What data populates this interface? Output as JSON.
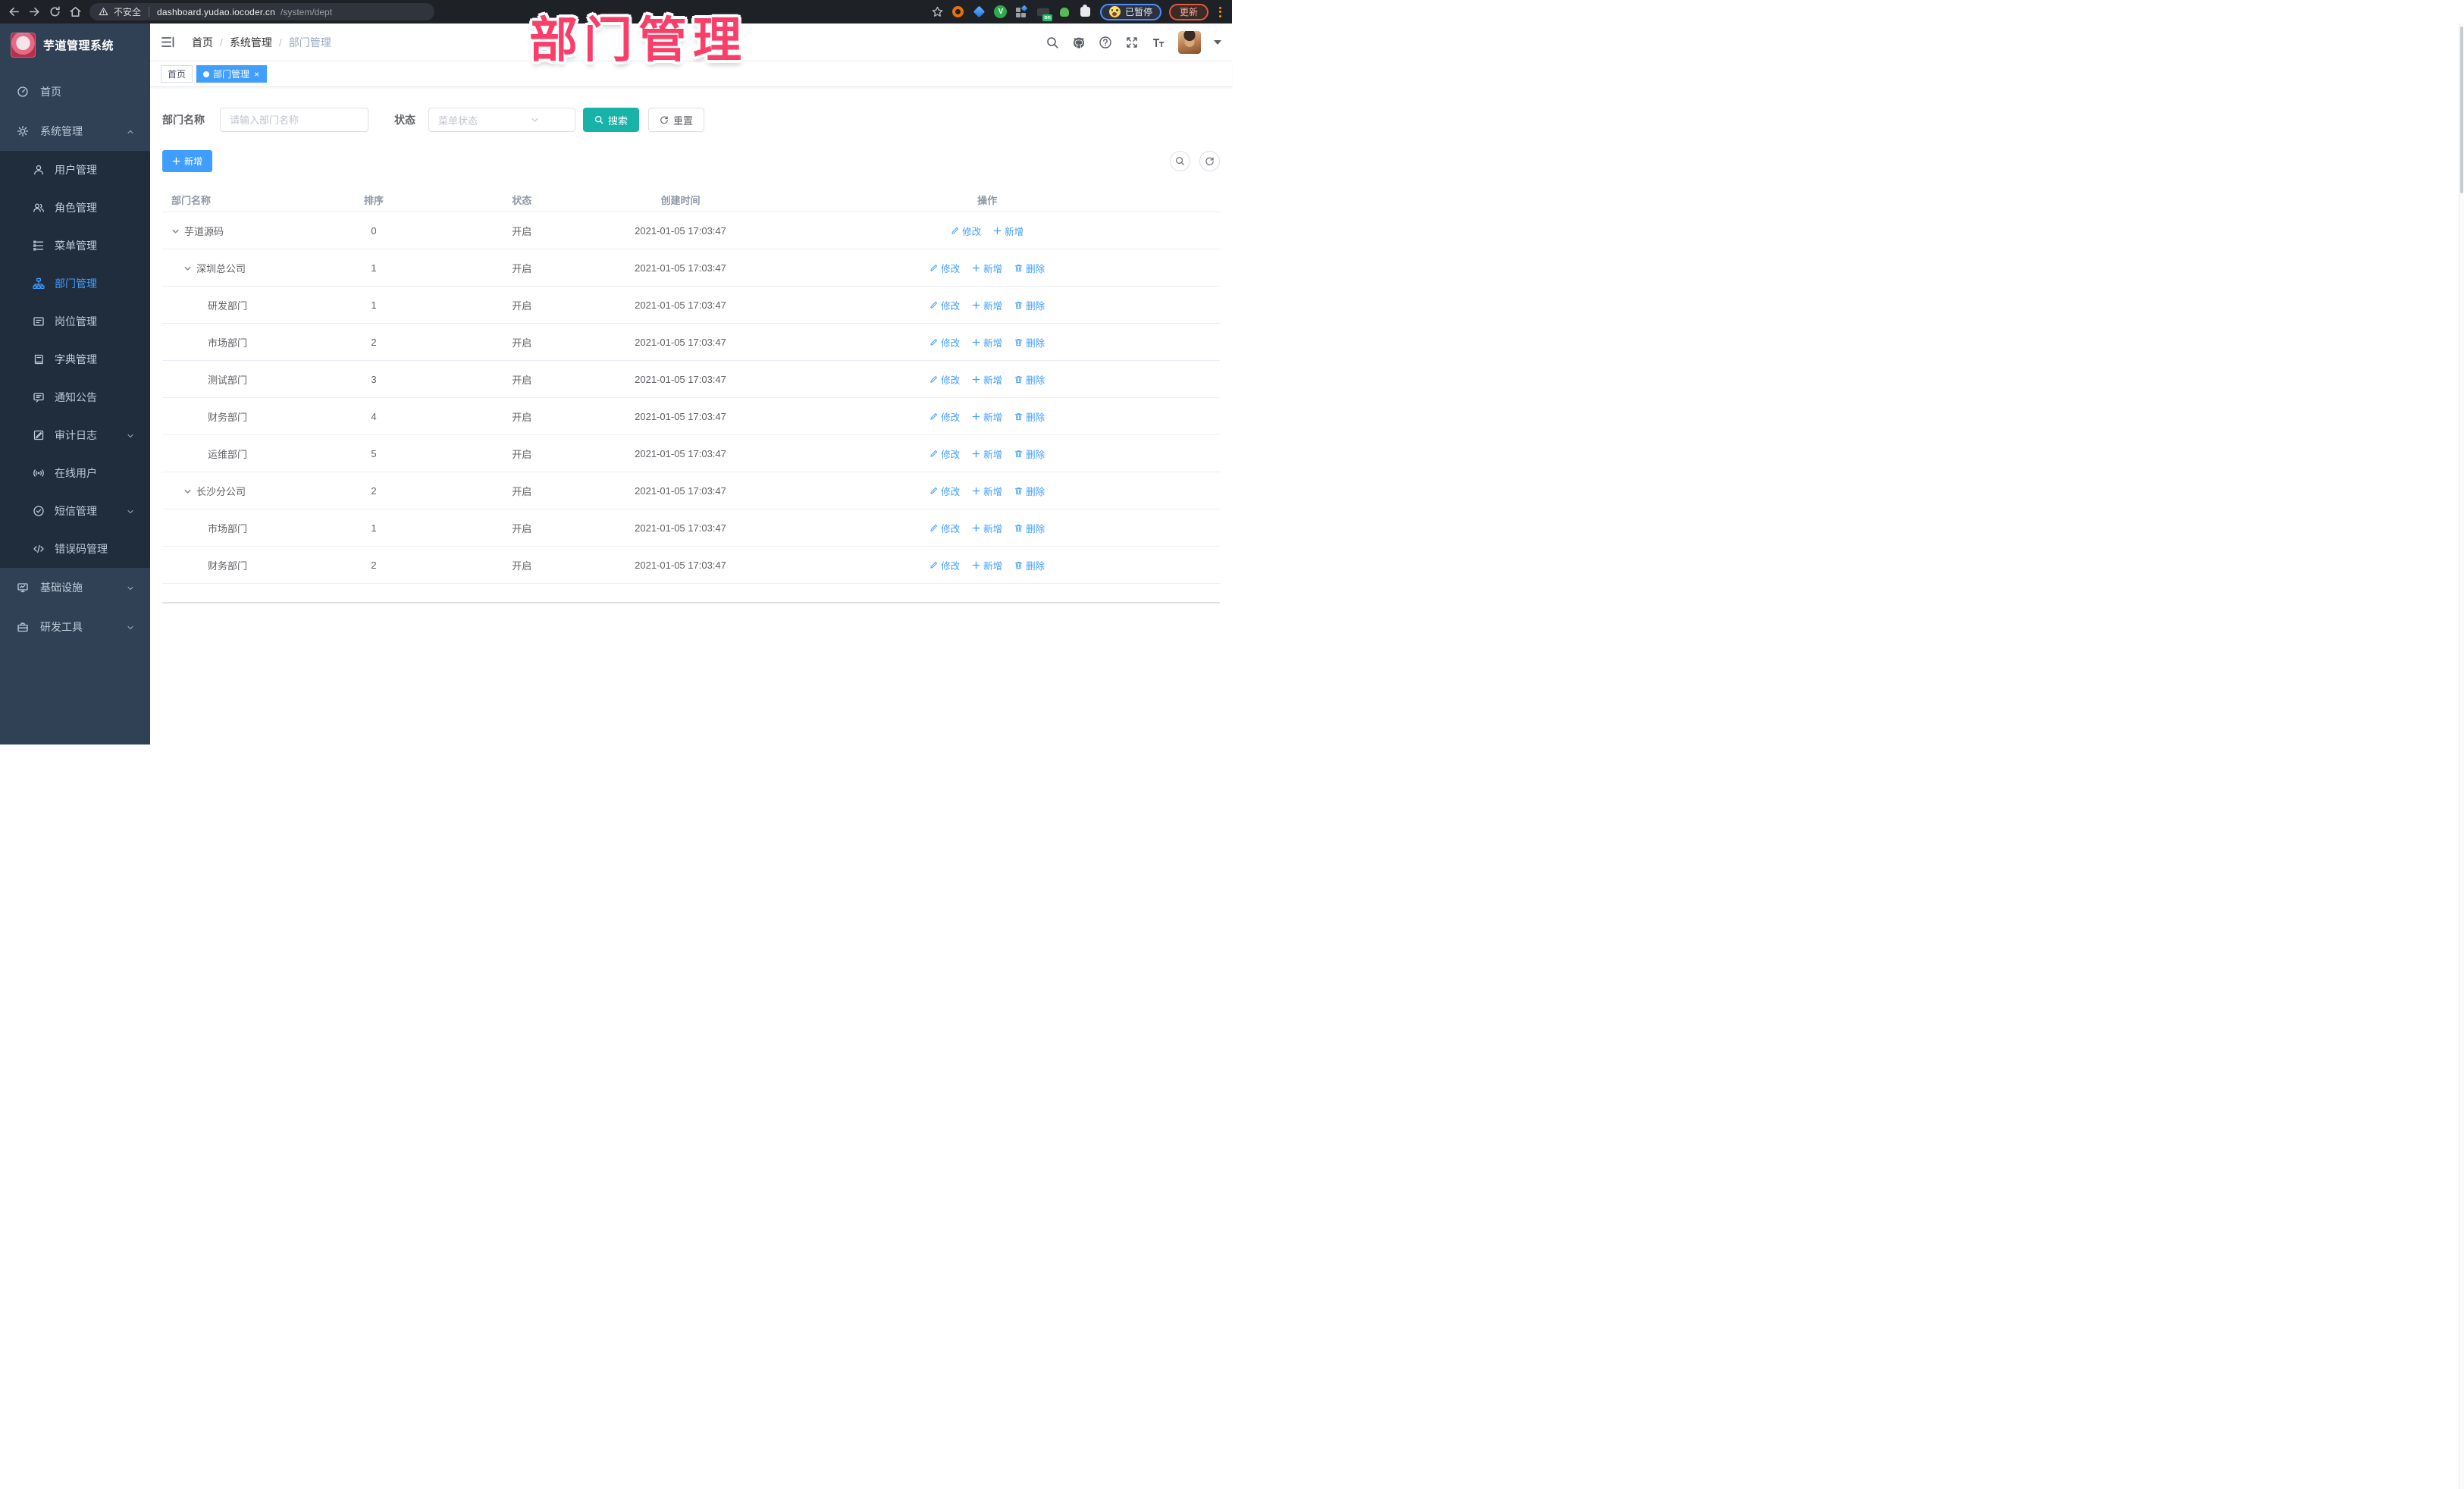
{
  "browser": {
    "security_label": "不安全",
    "url_domain": "dashboard.yudao.iocoder.cn",
    "url_path": "/system/dept",
    "profile_label": "已暂停",
    "update_label": "更新",
    "extension_on_badge": "on",
    "extension_check": "V"
  },
  "annotation": {
    "text": "部门管理",
    "color": "#fa3e6a"
  },
  "sidebar": {
    "title": "芋道管理系统",
    "items": [
      {
        "label": "首页"
      },
      {
        "label": "系统管理"
      },
      {
        "label": "用户管理"
      },
      {
        "label": "角色管理"
      },
      {
        "label": "菜单管理"
      },
      {
        "label": "部门管理"
      },
      {
        "label": "岗位管理"
      },
      {
        "label": "字典管理"
      },
      {
        "label": "通知公告"
      },
      {
        "label": "审计日志"
      },
      {
        "label": "在线用户"
      },
      {
        "label": "短信管理"
      },
      {
        "label": "错误码管理"
      },
      {
        "label": "基础设施"
      },
      {
        "label": "研发工具"
      }
    ]
  },
  "header": {
    "breadcrumb": [
      "首页",
      "系统管理",
      "部门管理"
    ]
  },
  "tags": [
    {
      "label": "首页"
    },
    {
      "label": "部门管理",
      "active": true,
      "close": "×"
    }
  ],
  "search": {
    "name_label": "部门名称",
    "name_placeholder": "请输入部门名称",
    "status_label": "状态",
    "status_placeholder": "菜单状态",
    "search_btn": "搜索",
    "reset_btn": "重置"
  },
  "toolbar": {
    "add_btn": "新增"
  },
  "table": {
    "headers": [
      "部门名称",
      "排序",
      "状态",
      "创建时间",
      "操作"
    ],
    "op_edit": "修改",
    "op_add": "新增",
    "op_delete": "删除",
    "accent_color": "#409eff",
    "rows": [
      {
        "name": "芋道源码",
        "sort": "0",
        "status": "开启",
        "time": "2021-01-05 17:03:47"
      },
      {
        "name": "深圳总公司",
        "sort": "1",
        "status": "开启",
        "time": "2021-01-05 17:03:47"
      },
      {
        "name": "研发部门",
        "sort": "1",
        "status": "开启",
        "time": "2021-01-05 17:03:47"
      },
      {
        "name": "市场部门",
        "sort": "2",
        "status": "开启",
        "time": "2021-01-05 17:03:47"
      },
      {
        "name": "测试部门",
        "sort": "3",
        "status": "开启",
        "time": "2021-01-05 17:03:47"
      },
      {
        "name": "财务部门",
        "sort": "4",
        "status": "开启",
        "time": "2021-01-05 17:03:47"
      },
      {
        "name": "运维部门",
        "sort": "5",
        "status": "开启",
        "time": "2021-01-05 17:03:47"
      },
      {
        "name": "长沙分公司",
        "sort": "2",
        "status": "开启",
        "time": "2021-01-05 17:03:47"
      },
      {
        "name": "市场部门",
        "sort": "1",
        "status": "开启",
        "time": "2021-01-05 17:03:47"
      },
      {
        "name": "财务部门",
        "sort": "2",
        "status": "开启",
        "time": "2021-01-05 17:03:47"
      }
    ]
  }
}
